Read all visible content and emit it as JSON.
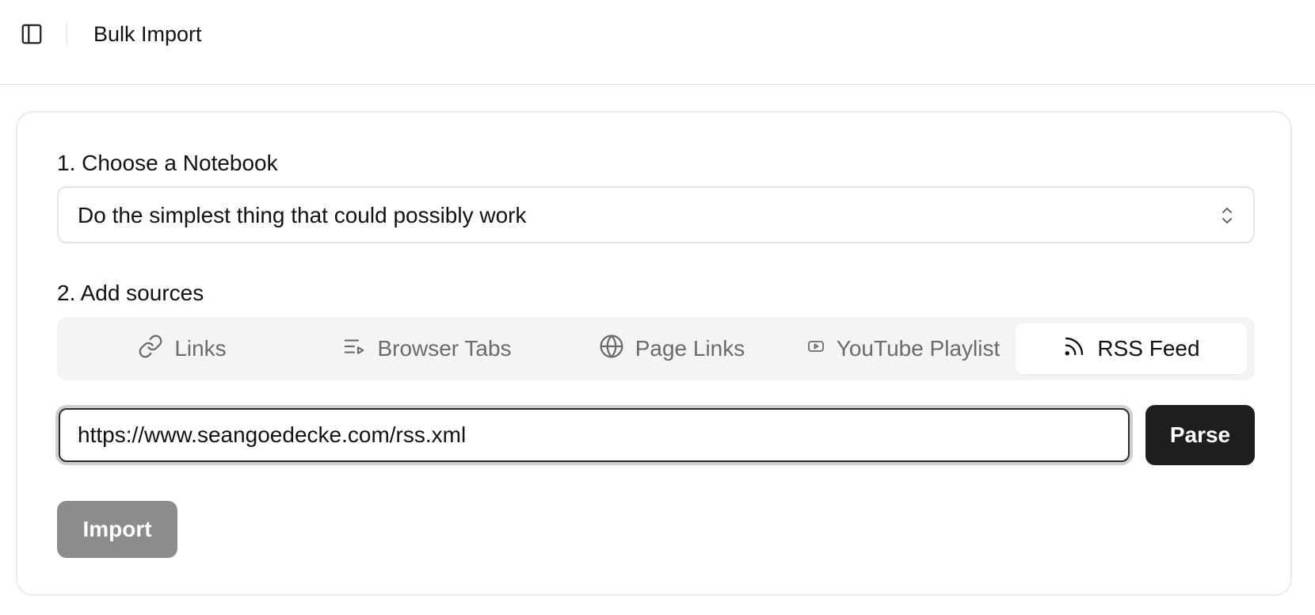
{
  "header": {
    "title": "Bulk Import",
    "toggle_icon": "sidebar-panel-icon"
  },
  "notebook": {
    "label": "1. Choose a Notebook",
    "selected": "Do the simplest thing that could possibly work"
  },
  "sources": {
    "label": "2. Add sources",
    "tabs": [
      {
        "label": "Links",
        "icon": "link-icon",
        "active": false
      },
      {
        "label": "Browser Tabs",
        "icon": "list-play-icon",
        "active": false
      },
      {
        "label": "Page Links",
        "icon": "globe-icon",
        "active": false
      },
      {
        "label": "YouTube Playlist",
        "icon": "youtube-icon",
        "active": false
      },
      {
        "label": "RSS Feed",
        "icon": "rss-icon",
        "active": true
      }
    ],
    "url_value": "https://www.seangoedecke.com/rss.xml",
    "parse_label": "Parse"
  },
  "actions": {
    "import_label": "Import"
  },
  "colors": {
    "primary_button": "#1e1e1e",
    "disabled_button": "#8c8c8c",
    "tab_bar_bg": "#f4f4f4"
  }
}
